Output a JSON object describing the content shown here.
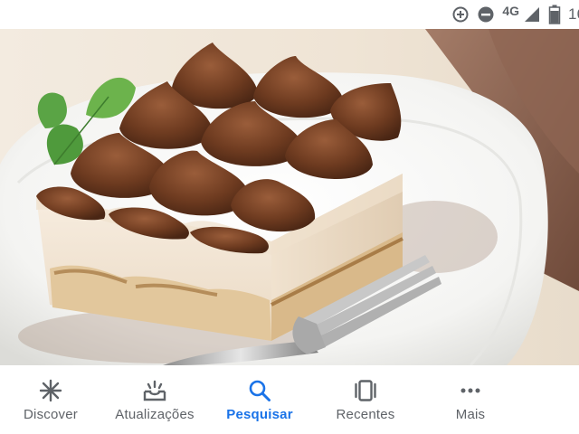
{
  "status_bar": {
    "network": "4G",
    "clock": "16",
    "icons": [
      "data-saver-icon",
      "do-not-disturb-icon",
      "cell-signal-icon",
      "battery-icon"
    ]
  },
  "image": {
    "subject": "tiramisu-dessert-photo"
  },
  "bottom_nav": {
    "active_color": "#1a73e8",
    "inactive_color": "#5f6368",
    "items": [
      {
        "label": "Discover",
        "icon": "asterisk-icon"
      },
      {
        "label": "Atualizações",
        "icon": "inbox-tray-icon"
      },
      {
        "label": "Pesquisar",
        "icon": "search-icon",
        "active": true
      },
      {
        "label": "Recentes",
        "icon": "tabs-icon"
      },
      {
        "label": "Mais",
        "icon": "more-horiz-icon"
      }
    ]
  }
}
